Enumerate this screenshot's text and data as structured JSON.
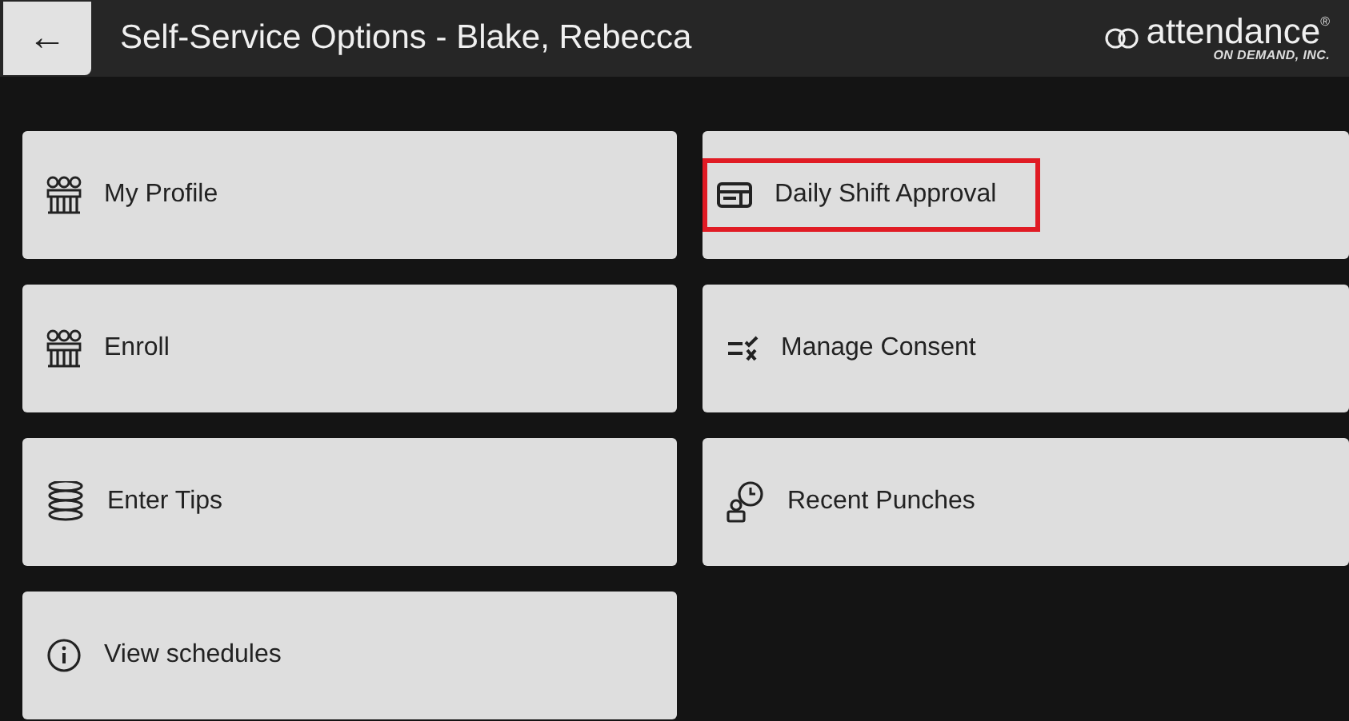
{
  "header": {
    "back": "←",
    "title": "Self-Service Options - Blake, Rebecca",
    "logo": {
      "name": "attendance",
      "mark": "®",
      "tagline": "ON DEMAND, INC."
    }
  },
  "options": [
    {
      "label": "My Profile",
      "kind": "people",
      "highlighted": false
    },
    {
      "label": "Daily Shift Approval",
      "kind": "card",
      "highlighted": true
    },
    {
      "label": "Enroll",
      "kind": "people",
      "highlighted": false
    },
    {
      "label": "Manage Consent",
      "kind": "consent",
      "highlighted": false
    },
    {
      "label": "Enter Tips",
      "kind": "coins",
      "highlighted": false
    },
    {
      "label": "Recent Punches",
      "kind": "clock",
      "highlighted": false
    },
    {
      "label": "View schedules",
      "kind": "info",
      "highlighted": false
    }
  ]
}
